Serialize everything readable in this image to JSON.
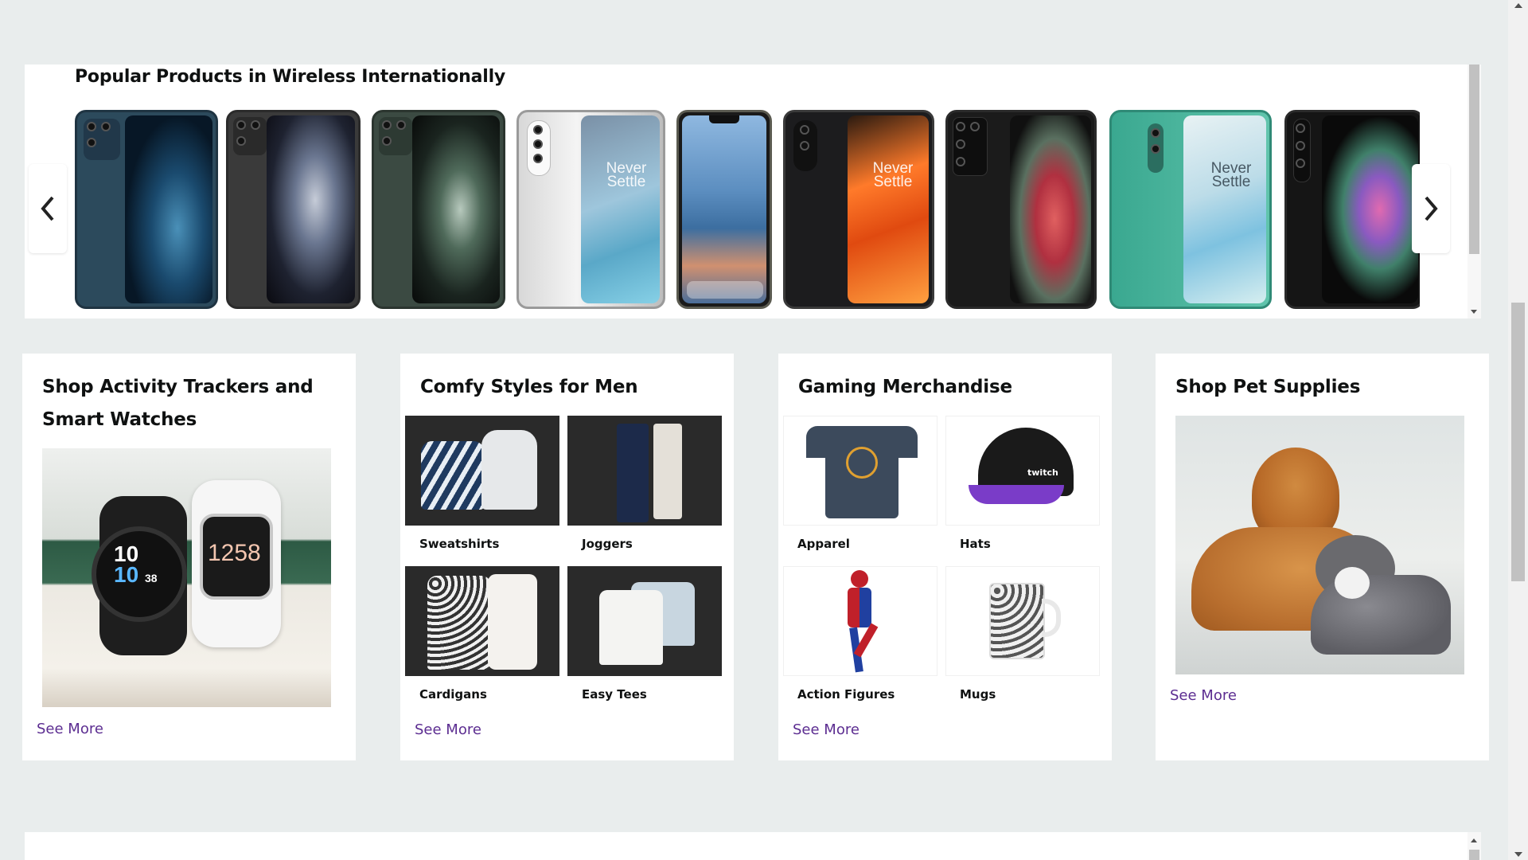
{
  "carousel": {
    "title": "Popular Products in Wireless Internationally",
    "prev_icon": "chevron-left-icon",
    "next_icon": "chevron-right-icon",
    "products": [
      {
        "name": "iphone-12-pro-blue",
        "overlay": ""
      },
      {
        "name": "iphone-11-pro-space-gray",
        "overlay": ""
      },
      {
        "name": "iphone-11-pro-midnight-green",
        "overlay": ""
      },
      {
        "name": "oneplus-9-pro-silver",
        "overlay": "Never\nSettle"
      },
      {
        "name": "iphone-x",
        "overlay": ""
      },
      {
        "name": "oneplus-9-black",
        "overlay": "Never\nSettle"
      },
      {
        "name": "samsung-galaxy-s21-ultra",
        "overlay": ""
      },
      {
        "name": "oneplus-8-green",
        "overlay": "Never\nSettle"
      },
      {
        "name": "samsung-galaxy-z-fold3",
        "overlay": ""
      }
    ]
  },
  "cards": [
    {
      "title": "Shop Activity Trackers and Smart Watches",
      "see_more": "See More",
      "watch_texts": [
        "10",
        "38",
        "1258"
      ]
    },
    {
      "title": "Comfy Styles for Men",
      "see_more": "See More",
      "tiles": [
        {
          "label": "Sweatshirts"
        },
        {
          "label": "Joggers"
        },
        {
          "label": "Cardigans"
        },
        {
          "label": "Easy Tees"
        }
      ]
    },
    {
      "title": "Gaming Merchandise",
      "see_more": "See More",
      "tiles": [
        {
          "label": "Apparel"
        },
        {
          "label": "Hats"
        },
        {
          "label": "Action Figures"
        },
        {
          "label": "Mugs"
        }
      ],
      "hat_text": "twitch"
    },
    {
      "title": "Shop Pet Supplies",
      "see_more": "See More"
    }
  ],
  "colors": {
    "page_bg": "#e9eded",
    "link": "#5c2d91"
  }
}
